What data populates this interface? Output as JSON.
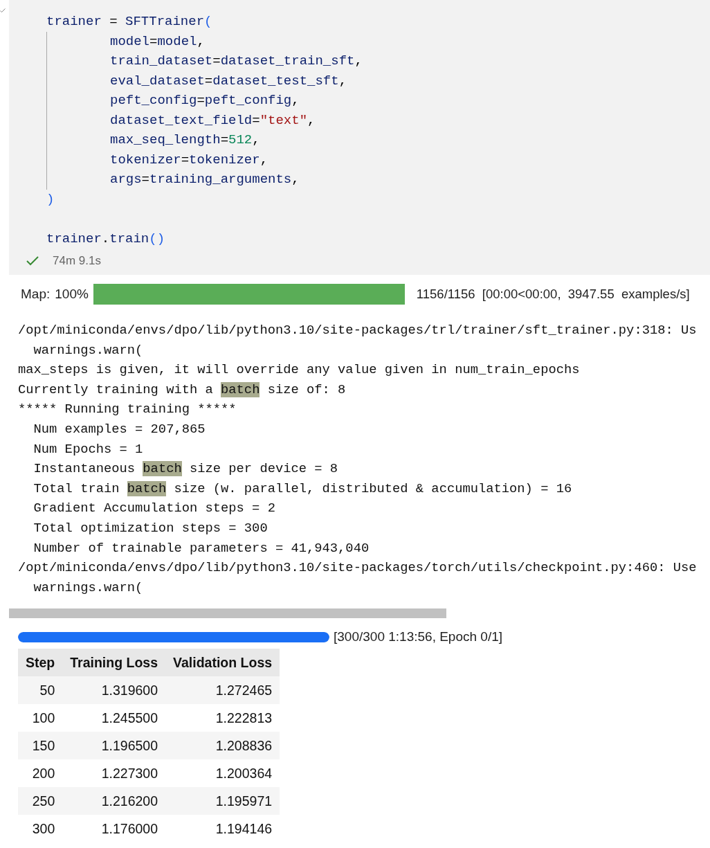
{
  "cell": {
    "code_lines": [
      {
        "indented": false,
        "tokens": [
          {
            "kind": "name",
            "text": "trainer"
          },
          {
            "kind": "op",
            "text": " = "
          },
          {
            "kind": "name",
            "text": "SFTTrainer"
          },
          {
            "kind": "bracket",
            "text": "("
          }
        ]
      },
      {
        "indented": true,
        "tokens": [
          {
            "kind": "name",
            "text": "model"
          },
          {
            "kind": "op",
            "text": "="
          },
          {
            "kind": "name",
            "text": "model"
          },
          {
            "kind": "op",
            "text": ","
          }
        ]
      },
      {
        "indented": true,
        "tokens": [
          {
            "kind": "name",
            "text": "train_dataset"
          },
          {
            "kind": "op",
            "text": "="
          },
          {
            "kind": "name",
            "text": "dataset_train_sft"
          },
          {
            "kind": "op",
            "text": ","
          }
        ]
      },
      {
        "indented": true,
        "tokens": [
          {
            "kind": "name",
            "text": "eval_dataset"
          },
          {
            "kind": "op",
            "text": "="
          },
          {
            "kind": "name",
            "text": "dataset_test_sft"
          },
          {
            "kind": "op",
            "text": ","
          }
        ]
      },
      {
        "indented": true,
        "tokens": [
          {
            "kind": "name",
            "text": "peft_config"
          },
          {
            "kind": "op",
            "text": "="
          },
          {
            "kind": "name",
            "text": "peft_config"
          },
          {
            "kind": "op",
            "text": ","
          }
        ]
      },
      {
        "indented": true,
        "tokens": [
          {
            "kind": "name",
            "text": "dataset_text_field"
          },
          {
            "kind": "op",
            "text": "="
          },
          {
            "kind": "string",
            "text": "\"text\""
          },
          {
            "kind": "op",
            "text": ","
          }
        ]
      },
      {
        "indented": true,
        "tokens": [
          {
            "kind": "name",
            "text": "max_seq_length"
          },
          {
            "kind": "op",
            "text": "="
          },
          {
            "kind": "number",
            "text": "512"
          },
          {
            "kind": "op",
            "text": ","
          }
        ]
      },
      {
        "indented": true,
        "tokens": [
          {
            "kind": "name",
            "text": "tokenizer"
          },
          {
            "kind": "op",
            "text": "="
          },
          {
            "kind": "name",
            "text": "tokenizer"
          },
          {
            "kind": "op",
            "text": ","
          }
        ]
      },
      {
        "indented": true,
        "tokens": [
          {
            "kind": "name",
            "text": "args"
          },
          {
            "kind": "op",
            "text": "="
          },
          {
            "kind": "name",
            "text": "training_arguments"
          },
          {
            "kind": "op",
            "text": ","
          }
        ]
      },
      {
        "indented": false,
        "tokens": [
          {
            "kind": "bracket",
            "text": ")"
          }
        ]
      },
      {
        "indented": false
      },
      {
        "indented": false,
        "tokens": [
          {
            "kind": "name",
            "text": "trainer"
          },
          {
            "kind": "op",
            "text": "."
          },
          {
            "kind": "name",
            "text": "train"
          },
          {
            "kind": "bracket",
            "text": "()"
          }
        ]
      }
    ],
    "status": {
      "succeeded": true,
      "duration": "74m 9.1s"
    }
  },
  "map_progress": {
    "label": "Map:",
    "percent": "100%",
    "level": 1.0,
    "info": "1156/1156  [00:00<00:00,  3947.55  examples/s]"
  },
  "output_lines": [
    [
      {
        "kind": "text",
        "text": "/opt/miniconda/envs/dpo/lib/python3.10/site-packages/trl/trainer/sft_trainer.py:318: Us"
      }
    ],
    [
      {
        "kind": "text",
        "text": "  warnings.warn("
      }
    ],
    [
      {
        "kind": "text",
        "text": "max_steps is given, it will override any value given in num_train_epochs"
      }
    ],
    [
      {
        "kind": "text",
        "text": "Currently training with a "
      },
      {
        "kind": "match",
        "text": "batch"
      },
      {
        "kind": "text",
        "text": " size of: 8"
      }
    ],
    [
      {
        "kind": "text",
        "text": "***** Running training *****"
      }
    ],
    [
      {
        "kind": "text",
        "text": "  Num examples = 207,865"
      }
    ],
    [
      {
        "kind": "text",
        "text": "  Num Epochs = 1"
      }
    ],
    [
      {
        "kind": "text",
        "text": "  Instantaneous "
      },
      {
        "kind": "match",
        "text": "batch"
      },
      {
        "kind": "text",
        "text": " size per device = 8"
      }
    ],
    [
      {
        "kind": "text",
        "text": "  Total train "
      },
      {
        "kind": "match",
        "text": "batch"
      },
      {
        "kind": "text",
        "text": " size (w. parallel, distributed & accumulation) = 16"
      }
    ],
    [
      {
        "kind": "text",
        "text": "  Gradient Accumulation steps = 2"
      }
    ],
    [
      {
        "kind": "text",
        "text": "  Total optimization steps = 300"
      }
    ],
    [
      {
        "kind": "text",
        "text": "  Number of trainable parameters = 41,943,040"
      }
    ],
    [
      {
        "kind": "text",
        "text": "/opt/miniconda/envs/dpo/lib/python3.10/site-packages/torch/utils/checkpoint.py:460: Use"
      }
    ],
    [
      {
        "kind": "text",
        "text": "  warnings.warn("
      }
    ]
  ],
  "training_progress": {
    "level": 1.0,
    "info": "[300/300 1:13:56, Epoch 0/1]"
  },
  "table": {
    "columns": [
      "Step",
      "Training Loss",
      "Validation Loss"
    ],
    "rows": [
      [
        "50",
        "1.319600",
        "1.272465"
      ],
      [
        "100",
        "1.245500",
        "1.222813"
      ],
      [
        "150",
        "1.196500",
        "1.208836"
      ],
      [
        "200",
        "1.227300",
        "1.200364"
      ],
      [
        "250",
        "1.216200",
        "1.195971"
      ],
      [
        "300",
        "1.176000",
        "1.194146"
      ]
    ]
  }
}
